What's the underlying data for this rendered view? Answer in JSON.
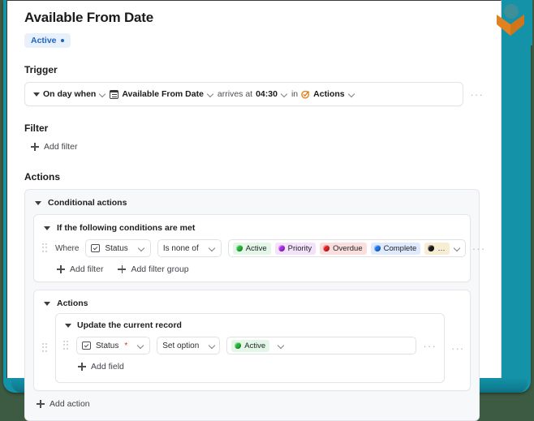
{
  "page": {
    "title": "Available From Date",
    "status_badge": {
      "label": "Active",
      "color": "#1c64c4",
      "bg": "#e8f1fb"
    }
  },
  "sections": {
    "trigger": {
      "heading": "Trigger",
      "row": {
        "when_label": "On day when",
        "field_label": "Available From Date",
        "field_icon": "calendar-icon",
        "arrives_label": "arrives at",
        "time_value": "04:30",
        "in_label": "in",
        "app_label": "Actions",
        "app_icon": "actions-check-circle-icon",
        "overflow": "···"
      }
    },
    "filter": {
      "heading": "Filter",
      "add_filter_label": "Add filter"
    },
    "actions": {
      "heading": "Actions",
      "conditional_card": {
        "title": "Conditional actions",
        "conditions_group": {
          "title": "If the following conditions are met",
          "where_label": "Where",
          "field_select": {
            "label": "Status",
            "icon": "select-field-icon"
          },
          "operator_select": {
            "label": "Is none of"
          },
          "values": [
            {
              "label": "Active",
              "bead": "#22b736",
              "bg": "#e3f6e7"
            },
            {
              "label": "Priority",
              "bead": "#a829e8",
              "bg": "#f4e2fb"
            },
            {
              "label": "Overdue",
              "bead": "#e32020",
              "bg": "#fbdede"
            },
            {
              "label": "Complete",
              "bead": "#1878ec",
              "bg": "#dfeafc"
            },
            {
              "label": "…",
              "bead": "#1a1a1a",
              "bg": "#f7edd2"
            }
          ],
          "add_filter_label": "Add filter",
          "add_filter_group_label": "Add filter group",
          "overflow": "···"
        },
        "actions_group": {
          "title": "Actions",
          "action_card": {
            "title": "Update the current record",
            "field_select": {
              "label": "Status",
              "required_marker": "*",
              "icon": "select-field-icon"
            },
            "operation_select": {
              "label": "Set option"
            },
            "value_pill": {
              "label": "Active",
              "bead": "#22b736",
              "bg": "#e3f6e7"
            },
            "add_field_label": "Add field",
            "overflow": "···"
          },
          "overflow": "···"
        }
      },
      "add_action_label": "Add action"
    }
  },
  "decor": {
    "logo_name": "app-logo",
    "teal": "#1392a8",
    "orange": "#e2811f"
  }
}
